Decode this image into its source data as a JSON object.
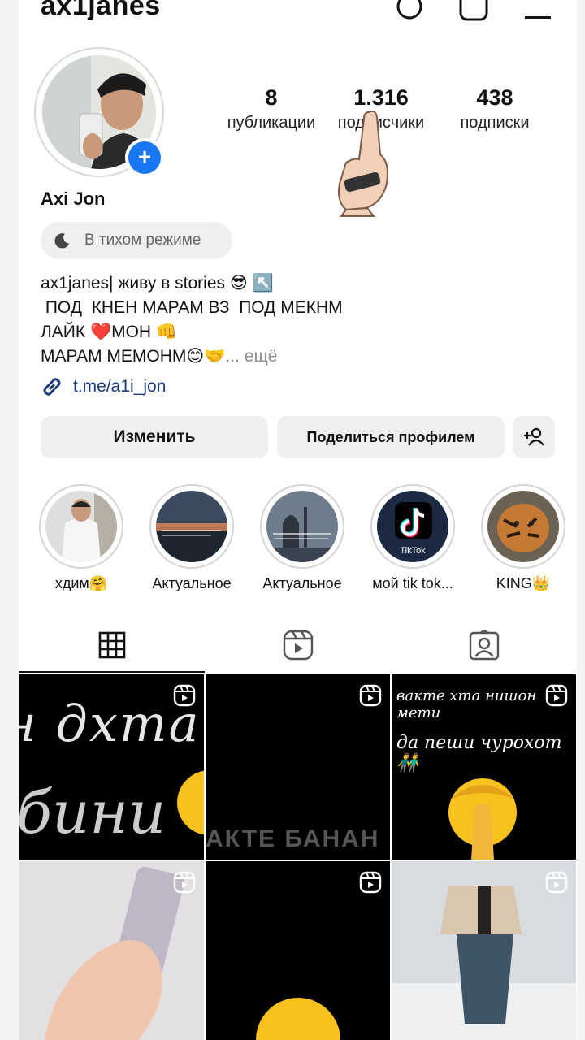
{
  "header": {
    "username": "ax1janes"
  },
  "profile": {
    "display_name": "Axi Jon",
    "status_chip": "В тихом режиме",
    "stats": [
      {
        "value": "8",
        "label": "публикации"
      },
      {
        "value": "1.316",
        "label": "подписчики"
      },
      {
        "value": "438",
        "label": "подписки"
      }
    ],
    "bio": [
      "ax1janes| живу в stories 😎 ↖️",
      " ПОД  КНЕН МАРАМ ВЗ  ПОД МЕКНМ",
      "ЛАЙК ❤️МОН 👊",
      "МАРАМ МЕМОНМ😊🤝"
    ],
    "bio_more": "... ещё",
    "link": "t.me/a1i_jon"
  },
  "actions": {
    "edit": "Изменить",
    "share": "Поделиться профилем"
  },
  "highlights": [
    {
      "label": "хдим🤗"
    },
    {
      "label": "Актуальное"
    },
    {
      "label": "Актуальное"
    },
    {
      "label": "мой tik tok...",
      "badge": "TikTok"
    },
    {
      "label": "KING👑"
    }
  ],
  "grid": {
    "post1_text": "н дхта",
    "post1_text2": "бини",
    "post2_text": "АКТЕ БАНАН",
    "post3_line1": "вакте хта нишон мети",
    "post3_line2": "да пеши чурохот 👬"
  },
  "colors": {
    "accent": "#1877f2",
    "link": "#1b3a78"
  }
}
